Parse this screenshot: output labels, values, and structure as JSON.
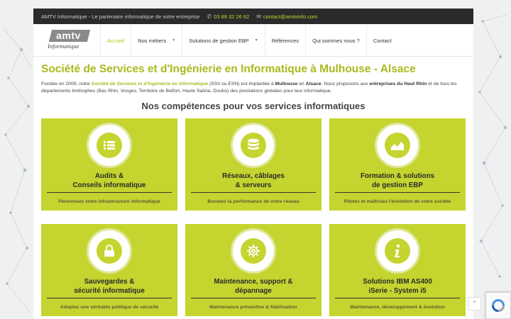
{
  "topbar": {
    "tagline": "AMTV Informatique - Le partenaire informatique de votre entreprise",
    "phone": "03 89 32 26 62",
    "email": "contact@amtvinfo.com"
  },
  "logo": {
    "brand": "amtv",
    "sub": "Informatique"
  },
  "menu": [
    {
      "label": "Accueil",
      "active": true,
      "dropdown": false
    },
    {
      "label": "Nos métiers",
      "active": false,
      "dropdown": true
    },
    {
      "label": "Solutions de gestion EBP",
      "active": false,
      "dropdown": true
    },
    {
      "label": "Références",
      "active": false,
      "dropdown": false
    },
    {
      "label": "Qui sommes nous ?",
      "active": false,
      "dropdown": false
    },
    {
      "label": "Contact",
      "active": false,
      "dropdown": false
    }
  ],
  "headline": "Société de Services et d'Ingénierie en Informatique à Mulhouse - Alsace",
  "intro": {
    "p1": "Fondée en 2000, notre ",
    "hl": "Société de Services et d'Ingénierie en Informatique",
    "p2": " (SSII ou ESN) est implantée à ",
    "b1": "Mulhouse",
    "p3": " en ",
    "b2": "Alsace",
    "p4": ". Nous proposons aux ",
    "b3": "entreprises du Haut Rhin",
    "p5": " et de tous les départements limitrophes (Bas Rhin, Vosges, Territoire de Belfort, Haute Saône, Doubs) des prestations globales pour leur informatique."
  },
  "section_title": "Nos compétences pour vos services informatiques",
  "cards": [
    {
      "icon": "list-icon",
      "line1": "Audits &",
      "line2": "Conseils informatique",
      "desc": "Pérennisez votre infrastructure informatique"
    },
    {
      "icon": "database-icon",
      "line1": "Réseaux, câblages",
      "line2": "& serveurs",
      "desc": "Boostez la performance de votre réseau"
    },
    {
      "icon": "area-chart-icon",
      "line1": "Formation & solutions",
      "line2": "de gestion EBP",
      "desc": "Pilotez et maîtrisez l'évolution de votre société"
    },
    {
      "icon": "lock-icon",
      "line1": "Sauvegardes &",
      "line2": "sécurité informatique",
      "desc": "Adoptez une véritable politique de sécurité"
    },
    {
      "icon": "gear-icon",
      "line1": "Maintenance, support &",
      "line2": "dépannage",
      "desc": "Maintenance préventive & fiabilisation"
    },
    {
      "icon": "info-icon",
      "line1": "Solutions IBM AS400",
      "line2": "iSerie - System i5",
      "desc": "Maintenance, développement & évolution"
    }
  ],
  "colors": {
    "accent": "#c5d42e",
    "headline": "#a9ba1e",
    "topbar": "#2b2b2b"
  }
}
